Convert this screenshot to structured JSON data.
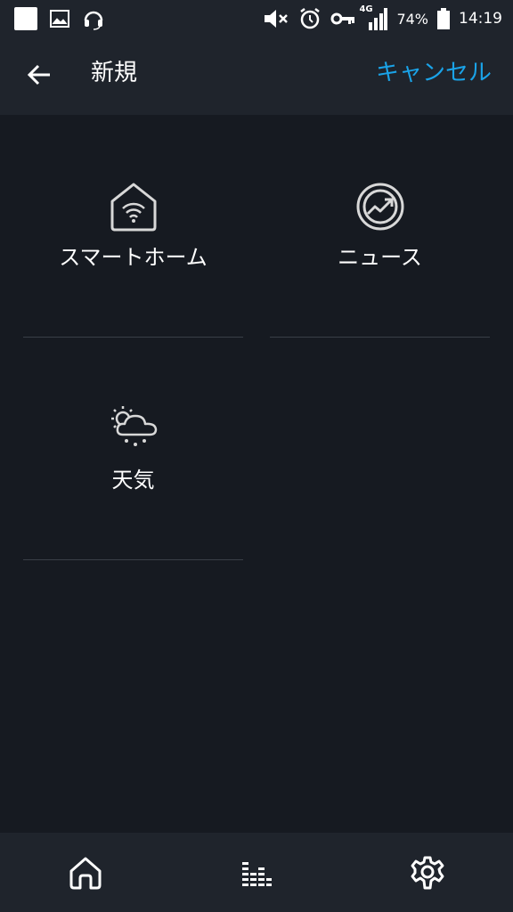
{
  "status_bar": {
    "network": "4G",
    "battery": "74%",
    "time": "14:19"
  },
  "header": {
    "title": "新規",
    "cancel_label": "キャンセル"
  },
  "grid": {
    "items": [
      {
        "label": "スマートホーム",
        "icon": "smart-home-icon"
      },
      {
        "label": "ニュース",
        "icon": "news-icon"
      },
      {
        "label": "天気",
        "icon": "weather-icon"
      }
    ]
  },
  "bottom_nav": {
    "items": [
      {
        "icon": "home-icon"
      },
      {
        "icon": "equalizer-icon"
      },
      {
        "icon": "gear-icon"
      }
    ]
  },
  "colors": {
    "background": "#161a21",
    "bar": "#1f242c",
    "accent": "#1aa3e8",
    "divider": "#3a3f47"
  }
}
